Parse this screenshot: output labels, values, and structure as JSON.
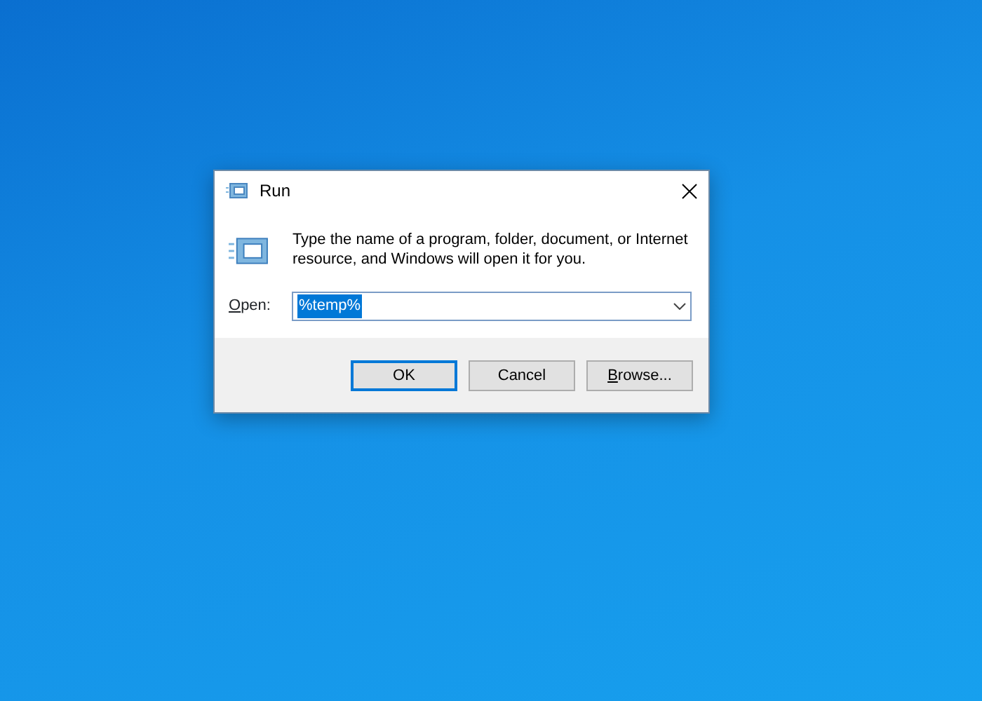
{
  "window": {
    "title": "Run"
  },
  "message": "Type the name of a program, folder, document, or Internet resource, and Windows will open it for you.",
  "open_field": {
    "label": "Open:",
    "value": "%temp%",
    "value_selected": true
  },
  "buttons": [
    {
      "label": "OK",
      "default": true
    },
    {
      "label": "Cancel",
      "default": false
    },
    {
      "label": "Browse...",
      "default": false
    }
  ]
}
